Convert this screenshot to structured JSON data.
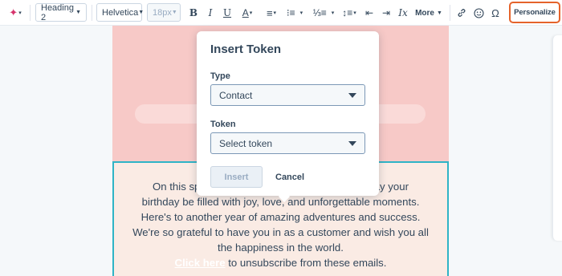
{
  "toolbar": {
    "heading_style": "Heading 2",
    "font_family": "Helvetica",
    "font_size": "18px",
    "bold": "B",
    "italic": "I",
    "underline": "U",
    "text_color": "A",
    "more_label": "More",
    "personalize_label": "Personalize",
    "icons": [
      "sparkle-icon",
      "bold-icon",
      "italic-icon",
      "underline-icon",
      "text-color-icon",
      "align-icon",
      "bullet-list-icon",
      "numbered-list-icon",
      "line-height-icon",
      "outdent-icon",
      "indent-icon",
      "clear-format-icon",
      "link-icon",
      "emoji-icon",
      "omega-icon"
    ],
    "accent_color": "#e5632b"
  },
  "popover": {
    "title": "Insert Token",
    "type_label": "Type",
    "type_value": "Contact",
    "token_label": "Token",
    "token_placeholder": "Select token",
    "insert_label": "Insert",
    "cancel_label": "Cancel"
  },
  "email": {
    "line1_left": "On this spe",
    "line1_right": "May your",
    "line2_left": "birthday be filled with joy, love,",
    "line2_right": "and unforgettable moments.",
    "line3": "Here's to another year of amazing adventures and success.",
    "line4": "We're so grateful to have you in as a customer and wish you all",
    "line5": "the happiness in the world.",
    "link_text": "Click here",
    "line6_rest": " to unsubscribe from these emails.",
    "hero_color": "#f7c9c7",
    "body_bg": "#faebe4",
    "selection_color": "#2fb4c6"
  }
}
